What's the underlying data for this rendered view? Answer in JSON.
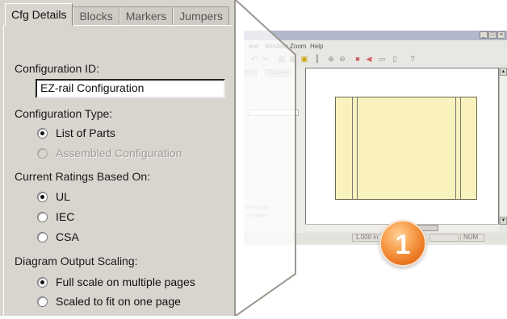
{
  "panel": {
    "tabs": [
      "Cfg Details",
      "Blocks",
      "Markers",
      "Jumpers"
    ],
    "config_id_label": "Configuration ID:",
    "config_id_value": "EZ-rail Configuration",
    "config_type_label": "Configuration Type:",
    "config_type_options": [
      {
        "label": "List of Parts",
        "selected": true,
        "enabled": true
      },
      {
        "label": "Assembled Configuration",
        "selected": false,
        "enabled": false
      }
    ],
    "ratings_label": "Current Ratings Based On:",
    "ratings_options": [
      {
        "label": "UL",
        "selected": true
      },
      {
        "label": "IEC",
        "selected": false
      },
      {
        "label": "CSA",
        "selected": false
      }
    ],
    "scaling_label": "Diagram Output Scaling:",
    "scaling_options": [
      {
        "label": "Full scale on multiple pages",
        "selected": true
      },
      {
        "label": "Scaled to fit on one page",
        "selected": false
      }
    ]
  },
  "app_window": {
    "menu": [
      "iew",
      "Window",
      "Zoom",
      "Help"
    ],
    "left_pane_tabs": [
      "ers",
      "Jumpers"
    ],
    "left_pane_faint_texts": [
      "ltiple pages",
      "one page"
    ],
    "status_zoom": "1.000 in",
    "status_mode": "NUM",
    "window_buttons": [
      "_",
      "□",
      "×"
    ]
  },
  "callout": {
    "number": "1",
    "color": "#f08a2c"
  }
}
